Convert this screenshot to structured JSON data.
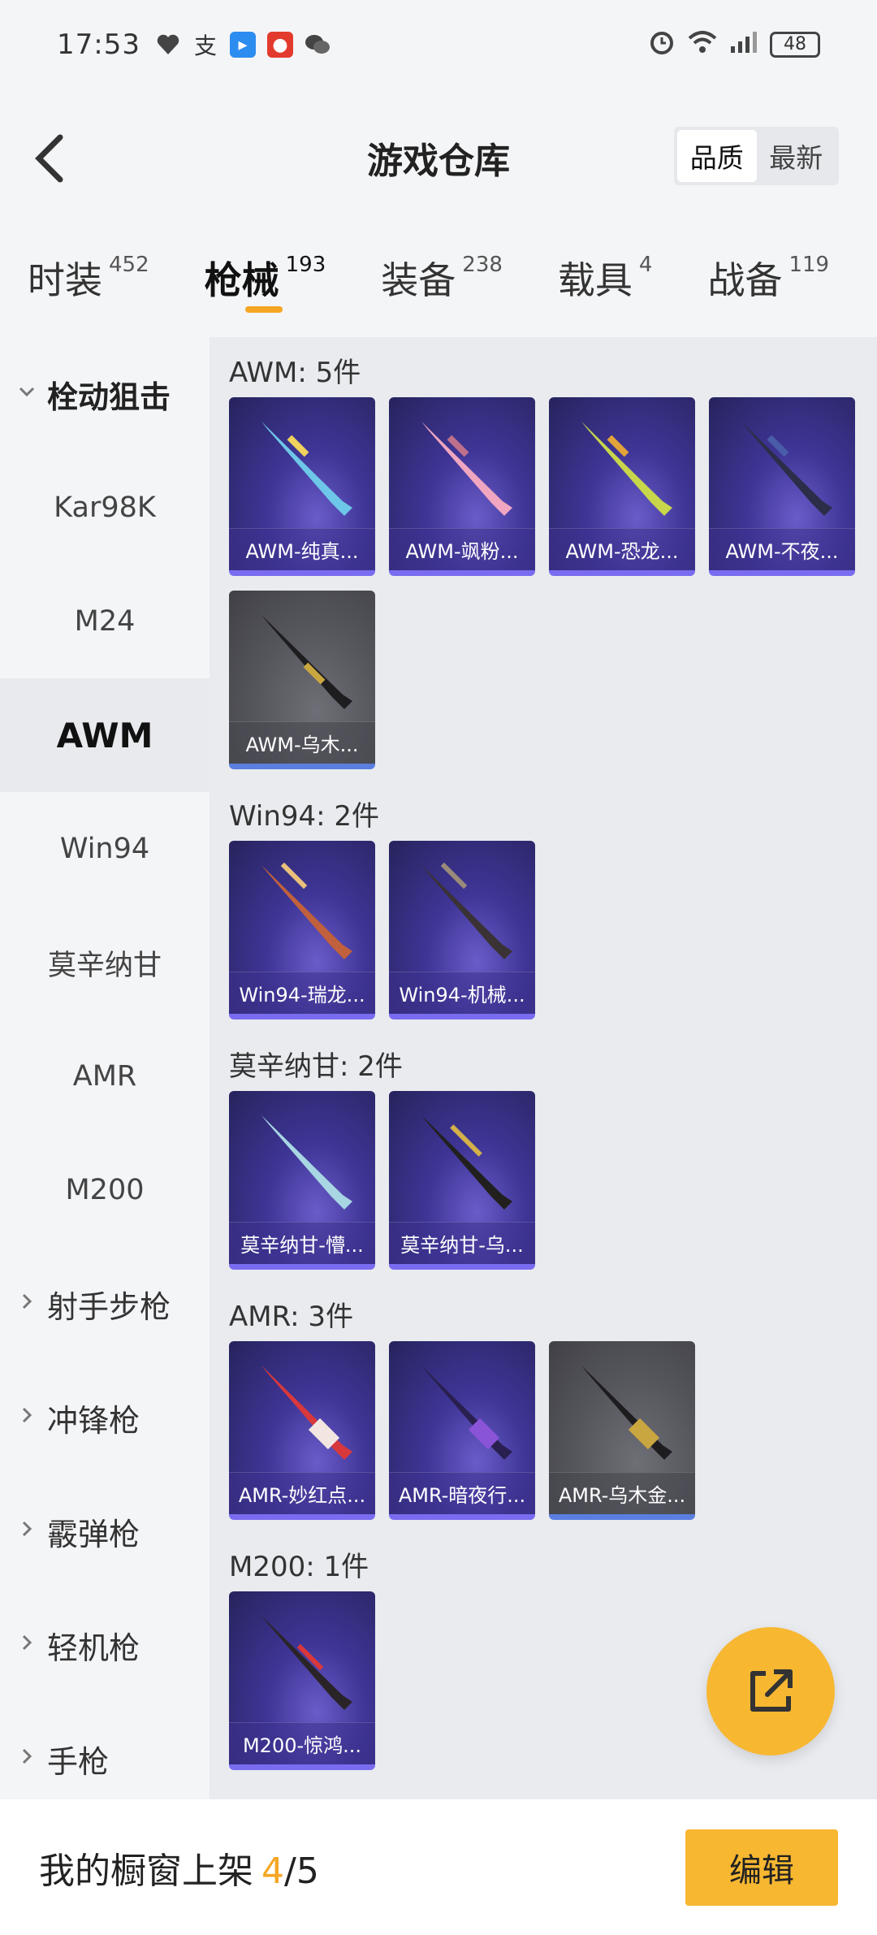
{
  "status_bar": {
    "time": "17:53",
    "battery": "48"
  },
  "header": {
    "title": "游戏仓库",
    "sort_options": [
      "品质",
      "最新"
    ]
  },
  "tabs": [
    {
      "label": "时装",
      "count": "452"
    },
    {
      "label": "枪械",
      "count": "193"
    },
    {
      "label": "装备",
      "count": "238"
    },
    {
      "label": "载具",
      "count": "4"
    },
    {
      "label": "战备",
      "count": "119"
    }
  ],
  "sidebar": {
    "groups": [
      {
        "label": "栓动狙击"
      },
      {
        "label": "射手步枪"
      },
      {
        "label": "冲锋枪"
      },
      {
        "label": "霰弹枪"
      },
      {
        "label": "轻机枪"
      },
      {
        "label": "手枪"
      }
    ],
    "items": [
      "Kar98K",
      "M24",
      "AWM",
      "Win94",
      "莫辛纳甘",
      "AMR",
      "M200"
    ]
  },
  "sections": [
    {
      "title": "AWM: 5件",
      "items": [
        "AWM-纯真...",
        "AWM-飒粉...",
        "AWM-恐龙...",
        "AWM-不夜...",
        "AWM-乌木..."
      ]
    },
    {
      "title": "Win94: 2件",
      "items": [
        "Win94-瑞龙...",
        "Win94-机械..."
      ]
    },
    {
      "title": "莫辛纳甘: 2件",
      "items": [
        "莫辛纳甘-懵...",
        "莫辛纳甘-乌..."
      ]
    },
    {
      "title": "AMR: 3件",
      "items": [
        "AMR-妙红点...",
        "AMR-暗夜行...",
        "AMR-乌木金..."
      ]
    },
    {
      "title": "M200: 1件",
      "items": [
        "M200-惊鸿..."
      ]
    }
  ],
  "bottom_bar": {
    "label": "我的橱窗上架",
    "count": "4",
    "separator": "/",
    "total": "5",
    "edit_label": "编辑"
  },
  "colors": {
    "accent": "#f7b731",
    "card_purple": "#3e3596",
    "card_grey": "#55555c"
  }
}
